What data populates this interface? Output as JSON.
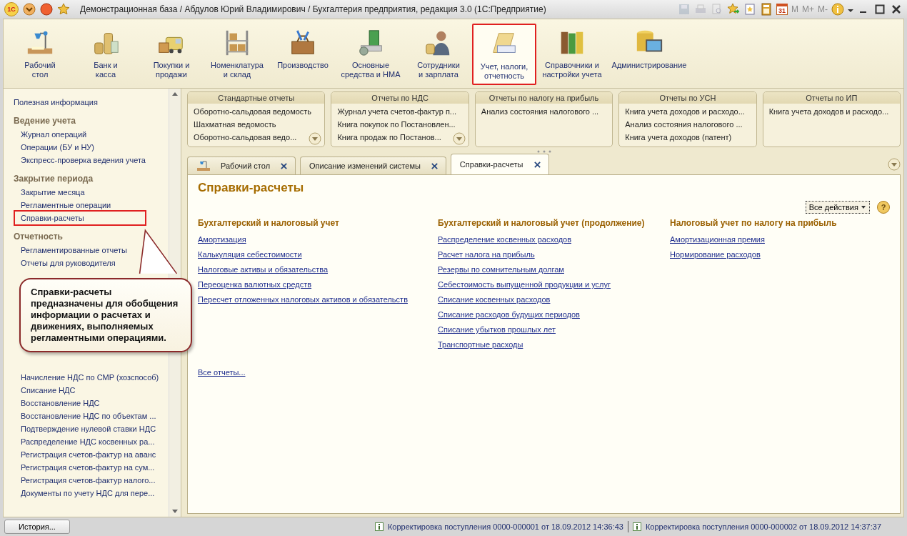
{
  "window": {
    "logo": "1С",
    "title": "Демонстрационная база / Абдулов Юрий Владимирович / Бухгалтерия предприятия, редакция 3.0  (1С:Предприятие)",
    "calendar_day": "31",
    "memory_buttons": [
      {
        "label": "M",
        "disabled": true
      },
      {
        "label": "M+",
        "disabled": true
      },
      {
        "label": "M-",
        "disabled": true
      }
    ]
  },
  "sections": [
    {
      "label": "Рабочий\nстол",
      "selected": false
    },
    {
      "label": "Банк и\nкасса",
      "selected": false
    },
    {
      "label": "Покупки и\nпродажи",
      "selected": false
    },
    {
      "label": "Номенклатура\nи склад",
      "selected": false
    },
    {
      "label": "Производство",
      "selected": false
    },
    {
      "label": "Основные\nсредства и НМА",
      "selected": false
    },
    {
      "label": "Сотрудники\nи зарплата",
      "selected": false
    },
    {
      "label": "Учет, налоги,\nотчетность",
      "selected": true
    },
    {
      "label": "Справочники и\nнастройки учета",
      "selected": false
    },
    {
      "label": "Администрирование",
      "selected": false
    }
  ],
  "sidebar": {
    "groups": [
      {
        "items": [
          {
            "label": "Полезная информация",
            "marked": false
          }
        ]
      },
      {
        "heading": "Ведение учета",
        "items": [
          {
            "label": "Журнал операций",
            "marked": false
          },
          {
            "label": "Операции (БУ и НУ)",
            "marked": false
          },
          {
            "label": "Экспресс-проверка ведения учета",
            "marked": false
          }
        ]
      },
      {
        "heading": "Закрытие периода",
        "items": [
          {
            "label": "Закрытие месяца",
            "marked": false
          },
          {
            "label": "Регламентные операции",
            "marked": false
          },
          {
            "label": "Справки-расчеты",
            "marked": true
          }
        ]
      },
      {
        "heading": "Отчетность",
        "items": [
          {
            "label": "Регламентированные отчеты",
            "marked": false
          },
          {
            "label": "Отчеты для руководителя",
            "marked": false
          }
        ]
      },
      {
        "items": [
          {
            "label": "Начисление НДС по СМР (хозспособ)",
            "marked": false
          },
          {
            "label": "Списание НДС",
            "marked": false
          },
          {
            "label": "Восстановление НДС",
            "marked": false
          },
          {
            "label": "Восстановление НДС по объектам ...",
            "marked": false
          },
          {
            "label": "Подтверждение нулевой ставки НДС",
            "marked": false
          },
          {
            "label": "Распределение НДС косвенных ра...",
            "marked": false
          },
          {
            "label": "Регистрация счетов-фактур на аванс",
            "marked": false
          },
          {
            "label": "Регистрация счетов-фактур на сум...",
            "marked": false
          },
          {
            "label": "Регистрация счетов-фактур налого...",
            "marked": false
          },
          {
            "label": "Документы по учету НДС для пере...",
            "marked": false
          }
        ]
      }
    ],
    "callout": "Справки-расчеты предназначены для обобщения информации о расчетах и движениях, выполняемых регламентными операциями."
  },
  "report_panels": [
    {
      "title": "Стандартные отчеты",
      "items": [
        "Оборотно-сальдовая ведомость",
        "Шахматная ведомость",
        "Оборотно-сальдовая ведо..."
      ],
      "has_more": true
    },
    {
      "title": "Отчеты по НДС",
      "items": [
        "Журнал учета счетов-фактур п...",
        "Книга покупок по Постановлен...",
        "Книга продаж по Постанов..."
      ],
      "has_more": true
    },
    {
      "title": "Отчеты по налогу на прибыль",
      "items": [
        "Анализ состояния налогового ..."
      ],
      "has_more": false
    },
    {
      "title": "Отчеты по УСН",
      "items": [
        "Книга учета доходов и расходо...",
        "Анализ состояния налогового ...",
        "Книга учета доходов (патент)"
      ],
      "has_more": false
    },
    {
      "title": "Отчеты по ИП",
      "items": [
        "Книга учета доходов и расходо..."
      ],
      "has_more": false
    }
  ],
  "tabs": [
    {
      "label": "Рабочий стол",
      "selected": false
    },
    {
      "label": "Описание изменений системы",
      "selected": false
    },
    {
      "label": "Справки-расчеты",
      "selected": true
    }
  ],
  "page": {
    "title": "Справки-расчеты",
    "all_actions": "Все действия",
    "help": "?",
    "columns": [
      {
        "heading": "Бухгалтерский и налоговый учет",
        "links": [
          "Амортизация",
          "Калькуляция себестоимости",
          "Налоговые активы и обязательства",
          "Переоценка валютных средств",
          "Пересчет отложенных налоговых активов и обязательств"
        ]
      },
      {
        "heading": "Бухгалтерский и налоговый учет (продолжение)",
        "links": [
          "Распределение косвенных расходов",
          "Расчет налога на прибыль",
          "Резервы по сомнительным долгам",
          "Себестоимость выпущенной продукции и услуг",
          "Списание косвенных расходов",
          "Списание расходов будущих периодов",
          "Списание убытков прошлых лет",
          "Транспортные расходы"
        ]
      },
      {
        "heading": "Налоговый учет по налогу на прибыль",
        "links": [
          "Амортизационная премия",
          "Нормирование расходов"
        ]
      }
    ],
    "all_reports": "Все отчеты..."
  },
  "status_bar": {
    "history_button": "История...",
    "notifications": [
      "Корректировка поступления 0000-000001 от 18.09.2012 14:36:43",
      "Корректировка поступления 0000-000002 от 18.09.2012 14:37:37"
    ]
  }
}
